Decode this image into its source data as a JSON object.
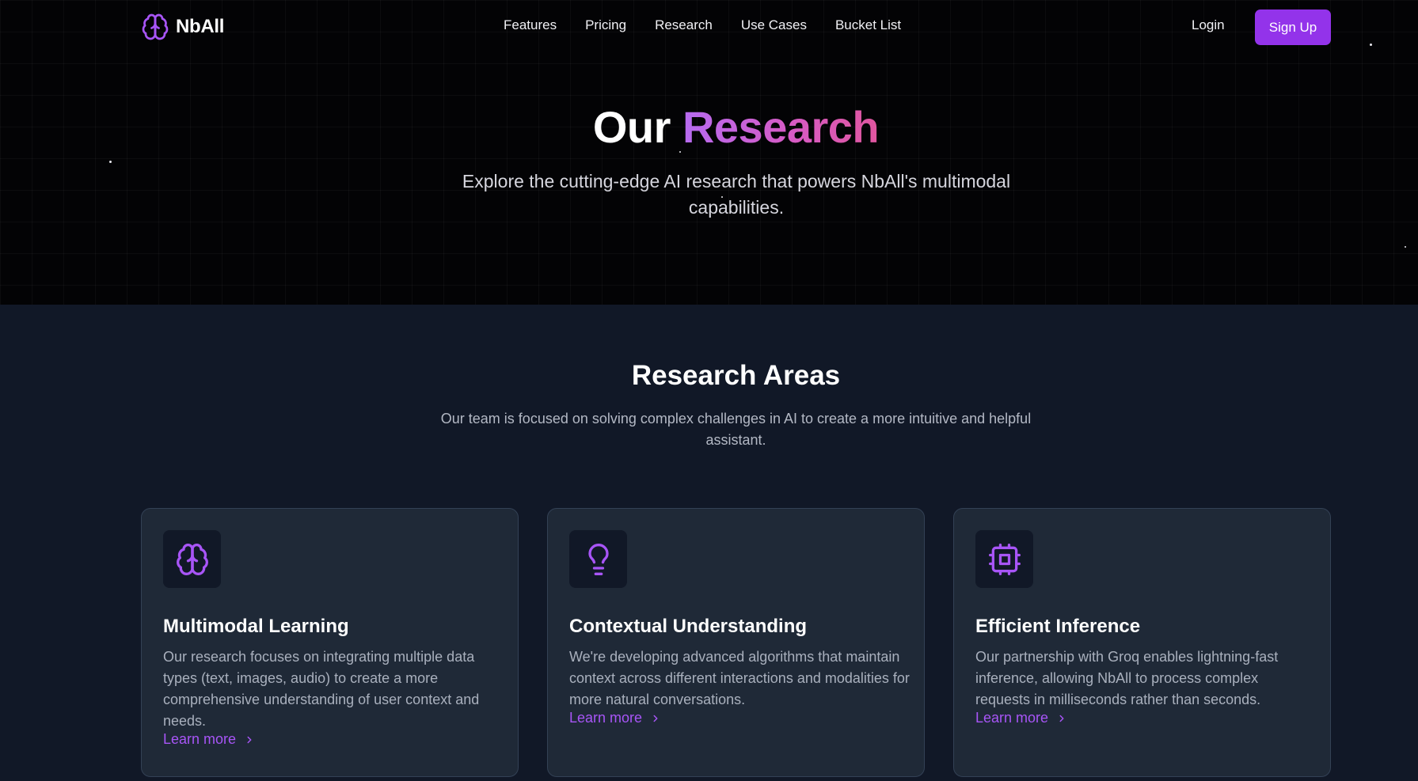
{
  "brand": {
    "name": "NbAll"
  },
  "nav": {
    "links": [
      "Features",
      "Pricing",
      "Research",
      "Use Cases",
      "Bucket List"
    ],
    "login": "Login",
    "signup": "Sign Up"
  },
  "hero": {
    "title_plain": "Our",
    "title_accent": "Research",
    "subtitle": "Explore the cutting-edge AI research that powers NbAll's multimodal capabilities."
  },
  "areas": {
    "title": "Research Areas",
    "subtitle": "Our team is focused on solving complex challenges in AI to create a more intuitive and helpful assistant.",
    "cards": [
      {
        "icon": "brain-icon",
        "title": "Multimodal Learning",
        "description": "Our research focuses on integrating multiple data types (text, images, audio) to create a more comprehensive understanding of user context and needs.",
        "link": "Learn more"
      },
      {
        "icon": "lightbulb-icon",
        "title": "Contextual Understanding",
        "description": "We're developing advanced algorithms that maintain context across different interactions and modalities for more natural conversations.",
        "link": "Learn more"
      },
      {
        "icon": "cpu-icon",
        "title": "Efficient Inference",
        "description": "Our partnership with Groq enables lightning-fast inference, allowing NbAll to process complex requests in milliseconds rather than seconds.",
        "link": "Learn more"
      }
    ]
  },
  "colors": {
    "accent": "#9333ea",
    "accent_text": "#a855f7",
    "hero_bg": "#030305",
    "section_bg": "#111827",
    "card_bg": "#1f2937"
  }
}
